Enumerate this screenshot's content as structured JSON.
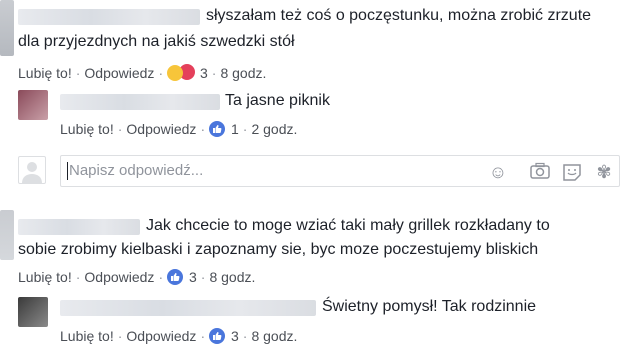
{
  "comments": [
    {
      "text_lines": [
        "słyszałam też coś o poczęstunku, można zrobić zrzute",
        "dla przyjezdnych na jakiś szwedzki stół"
      ],
      "like_label": "Lubię to!",
      "reply_label": "Odpowiedz",
      "reaction_count": "3",
      "time": "8 godz."
    },
    {
      "text_lines": [
        "Ta jasne piknik"
      ],
      "like_label": "Lubię to!",
      "reply_label": "Odpowiedz",
      "reaction_count": "1",
      "time": "2 godz."
    },
    {
      "text_lines": [
        "Jak chcecie to moge wziać taki mały grillek rozkładany to",
        "sobie zrobimy kielbaski i zapoznamy sie, byc moze poczestujemy bliskich"
      ],
      "like_label": "Lubię to!",
      "reply_label": "Odpowiedz",
      "reaction_count": "3",
      "time": "8 godz."
    },
    {
      "text_lines": [
        "Świetny pomysł! Tak rodzinnie"
      ],
      "like_label": "Lubię to!",
      "reply_label": "Odpowiedz",
      "reaction_count": "3",
      "time": "8 godz."
    }
  ],
  "reply_box": {
    "placeholder": "Napisz odpowiedź..."
  },
  "icons": {
    "like": "thumbs-up-icon",
    "haha": "haha-reaction-icon",
    "angry": "angry-reaction-icon",
    "emoji": "smiley-icon",
    "camera": "camera-icon",
    "sticker": "sticker-icon",
    "gif": "flower-icon"
  },
  "colors": {
    "like_blue": "#4a76dc",
    "text": "#1d2129",
    "meta": "#4b4f56"
  }
}
